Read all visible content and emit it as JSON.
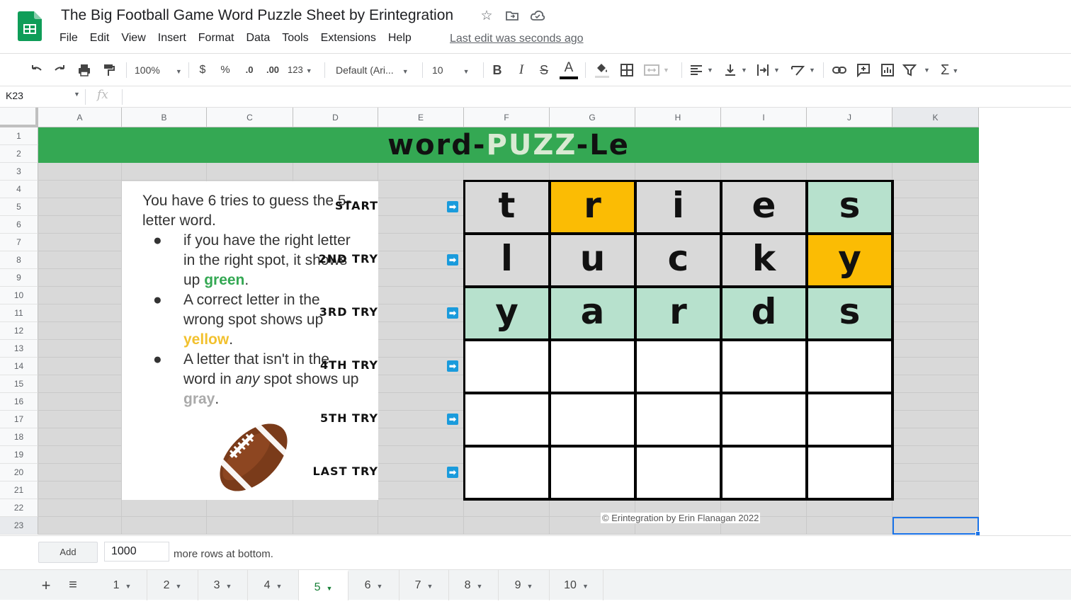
{
  "window": {
    "doc_title": "The Big Football Game Word Puzzle Sheet by Erintegration",
    "last_edit": "Last edit was seconds ago"
  },
  "menu": [
    "File",
    "Edit",
    "View",
    "Insert",
    "Format",
    "Data",
    "Tools",
    "Extensions",
    "Help"
  ],
  "toolbar": {
    "zoom": "100%",
    "currency": "$",
    "percent": "%",
    "dec_less": ".0",
    "dec_more": ".00",
    "number_format": "123",
    "font": "Default (Ari...",
    "font_size": "10",
    "bold": "B",
    "italic": "I",
    "strike": "S",
    "text_color": "A"
  },
  "formula_bar": {
    "cell_ref": "K23",
    "fx": "fx"
  },
  "columns": [
    "A",
    "B",
    "C",
    "D",
    "E",
    "F",
    "G",
    "H",
    "I",
    "J",
    "K"
  ],
  "rows": [
    "1",
    "2",
    "3",
    "4",
    "5",
    "6",
    "7",
    "8",
    "9",
    "10",
    "11",
    "12",
    "13",
    "14",
    "15",
    "16",
    "17",
    "18",
    "19",
    "20",
    "21",
    "22",
    "23"
  ],
  "banner": {
    "part1": "word-",
    "part2": "PUZZ",
    "part3": "-Le"
  },
  "instructions": {
    "intro": "You have 6 tries to guess the 5-letter word.",
    "b1_pre": "if you have the right letter in the right spot, it shows up ",
    "b1_word": "green",
    "b1_post": ".",
    "b2_pre": "A correct letter in the wrong spot shows up ",
    "b2_word": "yellow",
    "b2_post": ".",
    "b3_pre": "A letter that isn't in the word in ",
    "b3_em": "any",
    "b3_mid": " spot shows up ",
    "b3_word": "gray",
    "b3_post": ".",
    "bullet": "●"
  },
  "try_labels": [
    "START",
    "2ND TRY",
    "3RD TRY",
    "4TH TRY",
    "5TH TRY",
    "LAST TRY"
  ],
  "arrow_icon": "➡",
  "board": [
    [
      {
        "l": "t",
        "c": "#d9d9d9"
      },
      {
        "l": "r",
        "c": "#fbbc04"
      },
      {
        "l": "i",
        "c": "#d9d9d9"
      },
      {
        "l": "e",
        "c": "#d9d9d9"
      },
      {
        "l": "s",
        "c": "#b7e1cd"
      }
    ],
    [
      {
        "l": "l",
        "c": "#d9d9d9"
      },
      {
        "l": "u",
        "c": "#d9d9d9"
      },
      {
        "l": "c",
        "c": "#d9d9d9"
      },
      {
        "l": "k",
        "c": "#d9d9d9"
      },
      {
        "l": "y",
        "c": "#fbbc04"
      }
    ],
    [
      {
        "l": "y",
        "c": "#b7e1cd"
      },
      {
        "l": "a",
        "c": "#b7e1cd"
      },
      {
        "l": "r",
        "c": "#b7e1cd"
      },
      {
        "l": "d",
        "c": "#b7e1cd"
      },
      {
        "l": "s",
        "c": "#b7e1cd"
      }
    ],
    [
      {
        "l": "",
        "c": "#ffffff"
      },
      {
        "l": "",
        "c": "#ffffff"
      },
      {
        "l": "",
        "c": "#ffffff"
      },
      {
        "l": "",
        "c": "#ffffff"
      },
      {
        "l": "",
        "c": "#ffffff"
      }
    ],
    [
      {
        "l": "",
        "c": "#ffffff"
      },
      {
        "l": "",
        "c": "#ffffff"
      },
      {
        "l": "",
        "c": "#ffffff"
      },
      {
        "l": "",
        "c": "#ffffff"
      },
      {
        "l": "",
        "c": "#ffffff"
      }
    ],
    [
      {
        "l": "",
        "c": "#ffffff"
      },
      {
        "l": "",
        "c": "#ffffff"
      },
      {
        "l": "",
        "c": "#ffffff"
      },
      {
        "l": "",
        "c": "#ffffff"
      },
      {
        "l": "",
        "c": "#ffffff"
      }
    ]
  ],
  "credit": "© Erintegration by Erin Flanagan 2022",
  "add_rows": {
    "button": "Add",
    "value": "1000",
    "text": "more rows at bottom."
  },
  "sheet_tabs": [
    "1",
    "2",
    "3",
    "4",
    "5",
    "6",
    "7",
    "8",
    "9",
    "10"
  ],
  "active_tab": "5",
  "colors": {
    "brand_green": "#34a853",
    "yellow": "#fbbc04",
    "mint": "#b7e1cd",
    "gray": "#d9d9d9",
    "selection": "#1a73e8"
  }
}
